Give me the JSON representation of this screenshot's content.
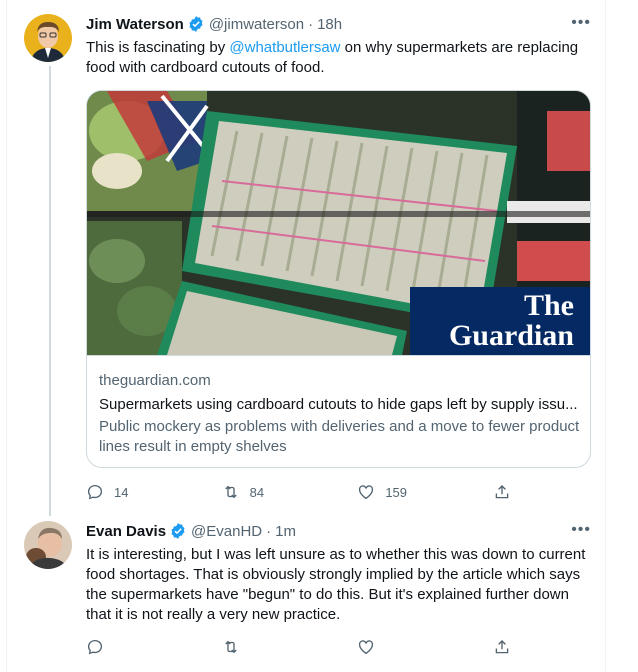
{
  "tweets": [
    {
      "name": "Jim Waterson",
      "handle": "@jimwaterson",
      "time": "18h",
      "text_before": "This is fascinating by ",
      "mention": "@whatbutlersaw",
      "text_after": " on why supermarkets are replacing food with cardboard cutouts of food.",
      "card": {
        "domain": "theguardian.com",
        "title": "Supermarkets using cardboard cutouts to hide gaps left by supply issu...",
        "description": "Public mockery as problems with deliveries and a move to fewer product lines result in empty shelves",
        "logo_line1": "The",
        "logo_line2": "Guardian"
      },
      "counts": {
        "replies": "14",
        "retweets": "84",
        "likes": "159"
      }
    },
    {
      "name": "Evan Davis",
      "handle": "@EvanHD",
      "time": "1m",
      "text": "It is interesting, but I was left unsure as to whether this was down to current food shortages. That is obviously strongly implied by the article which says the supermarkets have \"begun\" to do this. But it's explained further down that it is not really a very new practice."
    }
  ],
  "icons": {
    "more": "more-horizontal-icon",
    "verified": "verified-badge-icon",
    "reply": "reply-icon",
    "retweet": "retweet-icon",
    "like": "heart-icon",
    "share": "share-icon"
  },
  "colors": {
    "accent": "#1d9bf0",
    "secondary_text": "#536471",
    "guardian_blue": "#052962"
  },
  "more_glyph": "•••"
}
